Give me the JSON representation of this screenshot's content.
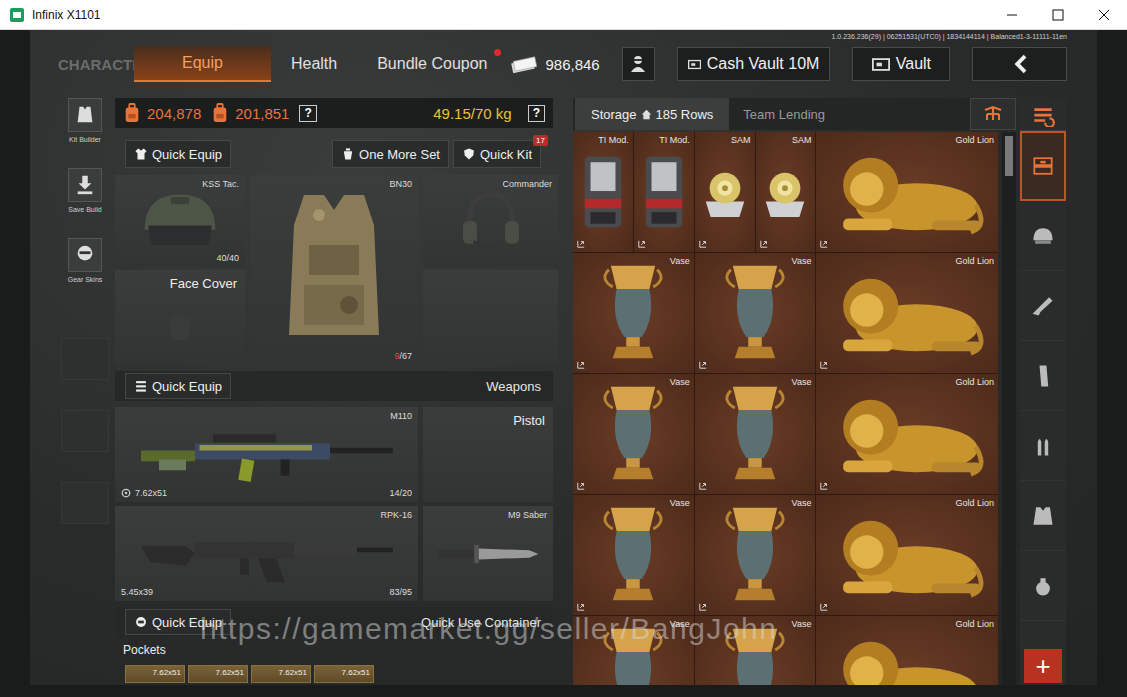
{
  "window": {
    "title": "Infinix X1101"
  },
  "build_info": "1.0.236.236(29) | 06251531(UTC0) | 1834144114 | Balanced1-3-11111-11en",
  "header": {
    "title": "CHARACTER"
  },
  "tabs": [
    {
      "label": "Equip",
      "selected": true,
      "notification": false
    },
    {
      "label": "Health",
      "selected": false,
      "notification": false
    },
    {
      "label": "Bundle Coupon",
      "selected": false,
      "notification": true
    }
  ],
  "currency": {
    "amount": "986,846"
  },
  "vault_buttons": [
    {
      "label": "Cash Vault 10M"
    },
    {
      "label": "Vault"
    }
  ],
  "side_tools": [
    {
      "label": "Kit Builder",
      "kind": "kit"
    },
    {
      "label": "Save Build",
      "kind": "save"
    },
    {
      "label": "Gear Skins",
      "kind": "skins"
    }
  ],
  "stats": {
    "values": [
      "204,878",
      "201,851"
    ],
    "weight": "49.15/70 kg",
    "help": "?"
  },
  "actions": {
    "quick_equip": "Quick Equip",
    "one_more_set": "One More Set",
    "quick_kit": "Quick Kit",
    "quick_kit_badge": "17"
  },
  "gear": {
    "helmet": {
      "label": "KSS Tac.",
      "current": "40",
      "rest": "/40",
      "low": false
    },
    "armor": {
      "label": "BN30",
      "current": "9",
      "rest": "/67",
      "low": true
    },
    "headset": {
      "label": "Commander"
    },
    "face": {
      "label": "Face Cover"
    }
  },
  "weapons": {
    "quick_equip": "Quick Equip",
    "title": "Weapons",
    "slots": [
      {
        "label": "M110",
        "kind": "rifle",
        "caliber": "7.62x51",
        "ammo": "14/20",
        "modded": true
      },
      {
        "label": "Pistol",
        "kind": "empty",
        "modded": false
      },
      {
        "label": "RPK-16",
        "kind": "lmg",
        "caliber": "5.45x39",
        "ammo": "83/95",
        "modded": false
      },
      {
        "label": "M9 Saber",
        "kind": "knife",
        "modded": false
      }
    ]
  },
  "container": {
    "quick_equip": "Quick Equip",
    "title": "Quick Use Container",
    "pockets_label": "Pockets",
    "pockets": [
      "7.62x51",
      "7.62x51",
      "7.62x51",
      "7.62x51"
    ]
  },
  "storage": {
    "tabs": [
      {
        "label": "Storage",
        "rows": "185 Rows",
        "selected": true
      },
      {
        "label": "Team Lending",
        "selected": false
      }
    ],
    "items": [
      {
        "label": "TI Mod.",
        "kind": "tmod"
      },
      {
        "label": "TI Mod.",
        "kind": "tmod"
      },
      {
        "label": "SAM",
        "kind": "sam"
      },
      {
        "label": "SAM",
        "kind": "sam"
      },
      {
        "label": "Gold Lion",
        "kind": "lion"
      },
      {
        "label": "Vase",
        "kind": "vase"
      },
      {
        "label": "Vase",
        "kind": "vase"
      },
      {
        "label": "Gold Lion",
        "kind": "lion"
      },
      {
        "label": "Vase",
        "kind": "vase"
      },
      {
        "label": "Vase",
        "kind": "vase"
      },
      {
        "label": "Gold Lion",
        "kind": "lion"
      },
      {
        "label": "Vase",
        "kind": "vase"
      },
      {
        "label": "Vase",
        "kind": "vase"
      },
      {
        "label": "Gold Lion",
        "kind": "lion"
      },
      {
        "label": "Vase",
        "kind": "vase"
      },
      {
        "label": "Vase",
        "kind": "vase"
      },
      {
        "label": "Gold Lion",
        "kind": "lion"
      }
    ]
  },
  "categories": [
    {
      "kind": "stack",
      "selected": true
    },
    {
      "kind": "headgear",
      "selected": false
    },
    {
      "kind": "rifle",
      "selected": false
    },
    {
      "kind": "magazine",
      "selected": false
    },
    {
      "kind": "ammo",
      "selected": false
    },
    {
      "kind": "rig",
      "selected": false
    },
    {
      "kind": "grenade",
      "selected": false
    }
  ],
  "add_button": "+",
  "watermark": "https://gamemarket.gg/seller/BangJohn"
}
